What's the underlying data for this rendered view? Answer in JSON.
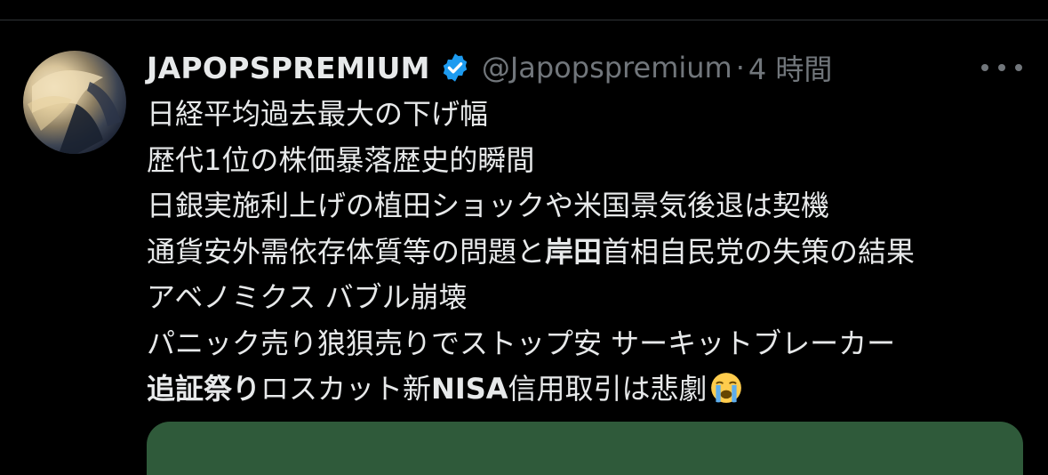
{
  "tweet": {
    "display_name": "JAPOPSPREMIUM",
    "handle": "@Japopspremium",
    "separator": "·",
    "timestamp": "4 時間",
    "lines": {
      "l1": "日経平均過去最大の下げ幅",
      "l2": "歴代1位の株価暴落歴史的瞬間",
      "l3": "日銀実施利上げの植田ショックや米国景気後退は契機",
      "l4a": "通貨安外需依存体質等の問題と",
      "l4b": "岸田",
      "l4c": "首相自民党の失策の結果",
      "l5": "アベノミクス バブル崩壊",
      "l6": "パニック売り狼狽売りでストップ安 サーキットブレーカー",
      "l7a": "追証祭り",
      "l7b": "ロスカット新",
      "l7c": "NISA",
      "l7d": "信用取引は悲劇"
    }
  },
  "icons": {
    "verified": "verified-badge-icon",
    "more": "more-options-icon",
    "emoji": "loudly-crying-face-emoji"
  },
  "colors": {
    "background": "#000000",
    "text_primary": "#e7e9ea",
    "text_secondary": "#71767b",
    "verified_blue": "#1d9bf0",
    "media_card": "#2f5a3a"
  }
}
